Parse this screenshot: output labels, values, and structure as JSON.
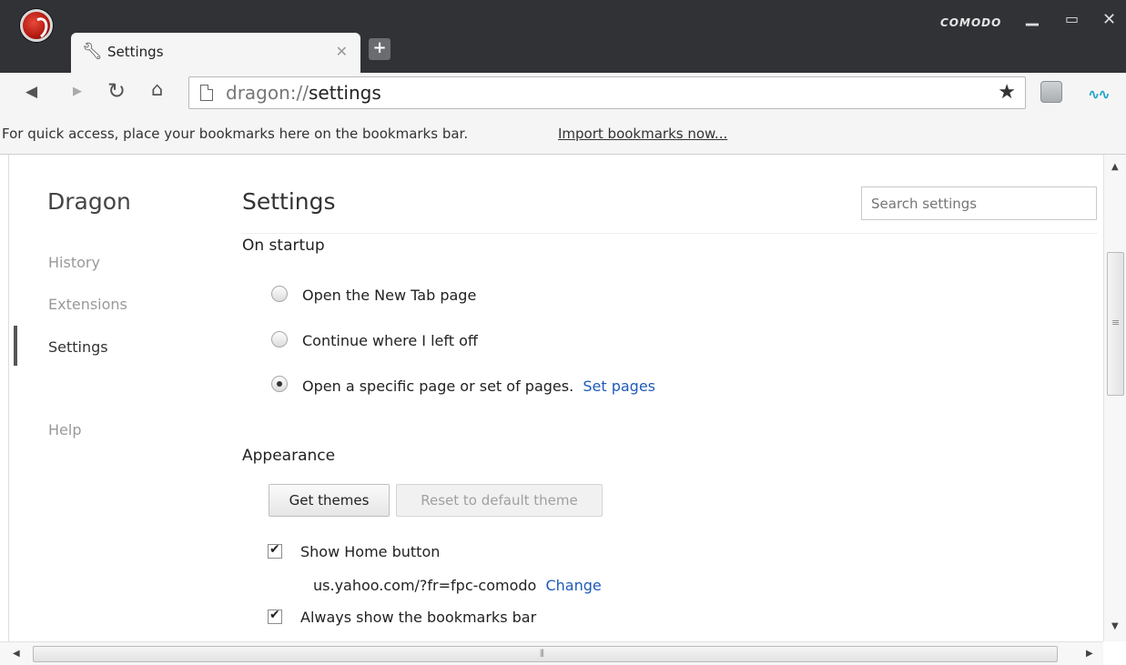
{
  "window": {
    "brand": "COMODO",
    "tab": {
      "title": "Settings"
    }
  },
  "toolbar": {
    "url_scheme": "dragon://",
    "url_path": "settings"
  },
  "bookmarks_bar": {
    "message": "For quick access, place your bookmarks here on the bookmarks bar.",
    "import_link": "Import bookmarks now..."
  },
  "sidebar": {
    "brand": "Dragon",
    "items": [
      {
        "label": "History"
      },
      {
        "label": "Extensions"
      },
      {
        "label": "Settings",
        "active": true
      },
      {
        "label": "Help"
      }
    ]
  },
  "main": {
    "title": "Settings",
    "search_placeholder": "Search settings",
    "startup": {
      "heading": "On startup",
      "options": [
        {
          "label": "Open the New Tab page",
          "checked": false
        },
        {
          "label": "Continue where I left off",
          "checked": false
        },
        {
          "label": "Open a specific page or set of pages.",
          "checked": true,
          "link": "Set pages"
        }
      ]
    },
    "appearance": {
      "heading": "Appearance",
      "get_themes": "Get themes",
      "reset_theme": "Reset to default theme",
      "show_home": "Show Home button",
      "home_url": "us.yahoo.com/?fr=fpc-comodo",
      "change_link": "Change",
      "show_bookmarks": "Always show the bookmarks bar"
    }
  },
  "icons": {
    "tab_icon": "wrench-icon",
    "close": "close-icon",
    "new_tab": "plus-icon",
    "back": "back-icon",
    "forward": "forward-icon",
    "reload": "reload-icon",
    "home": "home-icon",
    "bookmark": "star-icon"
  },
  "colors": {
    "titlebar": "#303236",
    "link": "#1e5bb8"
  }
}
